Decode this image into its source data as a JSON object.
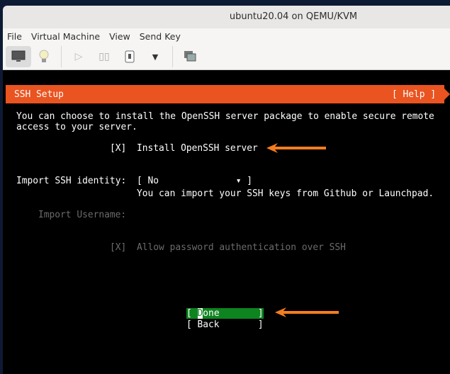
{
  "window": {
    "title": "ubuntu20.04 on QEMU/KVM"
  },
  "menu": [
    "File",
    "Virtual Machine",
    "View",
    "Send Key"
  ],
  "toolbar": [
    "console",
    "details",
    "run",
    "pause",
    "shutdown",
    "shutdown-menu",
    "snapshots"
  ],
  "header": {
    "title": "SSH Setup",
    "help": "[ Help ]"
  },
  "intro": [
    "You can choose to install the OpenSSH server package to enable secure remote",
    "access to your server."
  ],
  "install_ssh": {
    "checkbox": "[X]",
    "label": "Install OpenSSH server"
  },
  "import_identity": {
    "label": "Import SSH identity:",
    "value": "[ No              ▾ ]",
    "help": "You can import your SSH keys from Github or Launchpad."
  },
  "import_username": {
    "label": "Import Username:"
  },
  "allow_password": {
    "checkbox": "[X]",
    "label": "Allow password authentication over SSH"
  },
  "buttons": {
    "done_open": "[ ",
    "done_first": "D",
    "done_rest": "one",
    "done_close": "       ]",
    "back": "[ Back       ]"
  },
  "colors": {
    "accent": "#e95420",
    "selected": "#0e8420",
    "annotation": "#f57d1f"
  }
}
